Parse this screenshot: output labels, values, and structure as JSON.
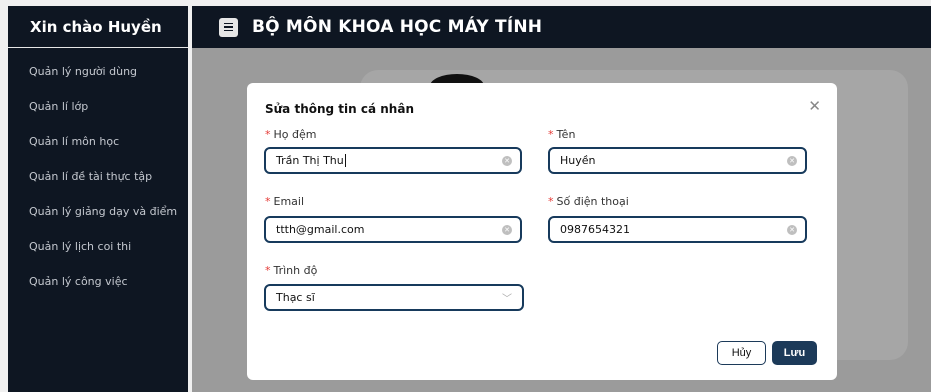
{
  "sidebar": {
    "greeting": "Xin chào Huyền",
    "items": [
      {
        "label": "Quản lý người dùng"
      },
      {
        "label": "Quản lí lớp"
      },
      {
        "label": "Quản lí môn học"
      },
      {
        "label": "Quản lí đề tài thực tập"
      },
      {
        "label": "Quản lý giảng dạy và điểm"
      },
      {
        "label": "Quản lý lịch coi thi"
      },
      {
        "label": "Quản lý công việc"
      }
    ]
  },
  "header": {
    "title": "BỘ MÔN KHOA HỌC MÁY TÍNH",
    "menu_icon": "menu-icon"
  },
  "modal": {
    "title": "Sửa thông tin cá nhân",
    "close_icon": "close-icon",
    "fields": {
      "ho_dem": {
        "label": "Họ đệm",
        "value": "Trần Thị Thu"
      },
      "ten": {
        "label": "Tên",
        "value": "Huyền"
      },
      "email": {
        "label": "Email",
        "value": "ttth@gmail.com"
      },
      "sdt": {
        "label": "Số điện thoại",
        "value": "0987654321"
      },
      "trinh_do": {
        "label": "Trình độ",
        "value": "Thạc sĩ"
      }
    },
    "required_mark": "*",
    "cancel_label": "Hủy",
    "save_label": "Lưu"
  },
  "colors": {
    "sidebar_bg": "#0e1622",
    "accent": "#1c3a59",
    "required": "#e53935"
  }
}
